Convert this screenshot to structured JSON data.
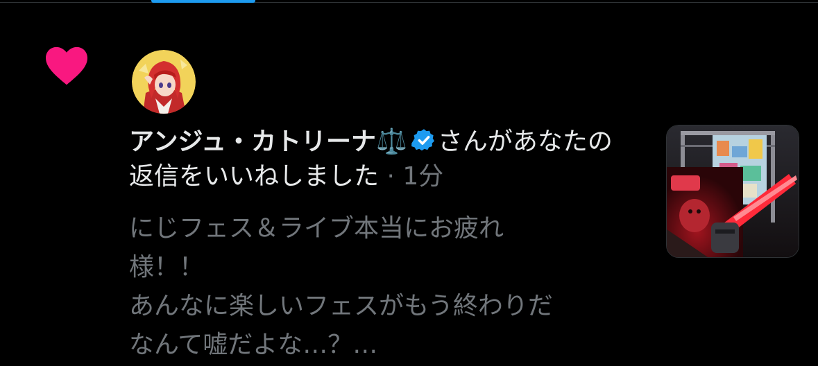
{
  "notification": {
    "type_icon": "heart-icon",
    "avatar_icon": "anime-character-avatar",
    "user_name": "アンジュ・カトリーナ",
    "name_emoji": "⚖️",
    "verified_icon": "verified-badge-icon",
    "action_text": "さんがあなたの返信をいいねしました",
    "separator": " · ",
    "timestamp": "1分",
    "preview_lines": [
      "にじフェス＆ライブ本当にお疲れ",
      "様！！",
      "あんなに楽しいフェスがもう終わりだ",
      "なんて嘘だよな…？…"
    ],
    "media_thumbnail": "event-photo-thumbnail"
  },
  "colors": {
    "background": "#000000",
    "heart": "#f91880",
    "verified": "#1d9bf0",
    "primary_text": "#e7e9ea",
    "secondary_text": "#71767b",
    "tab_indicator": "#1d9bf0"
  }
}
